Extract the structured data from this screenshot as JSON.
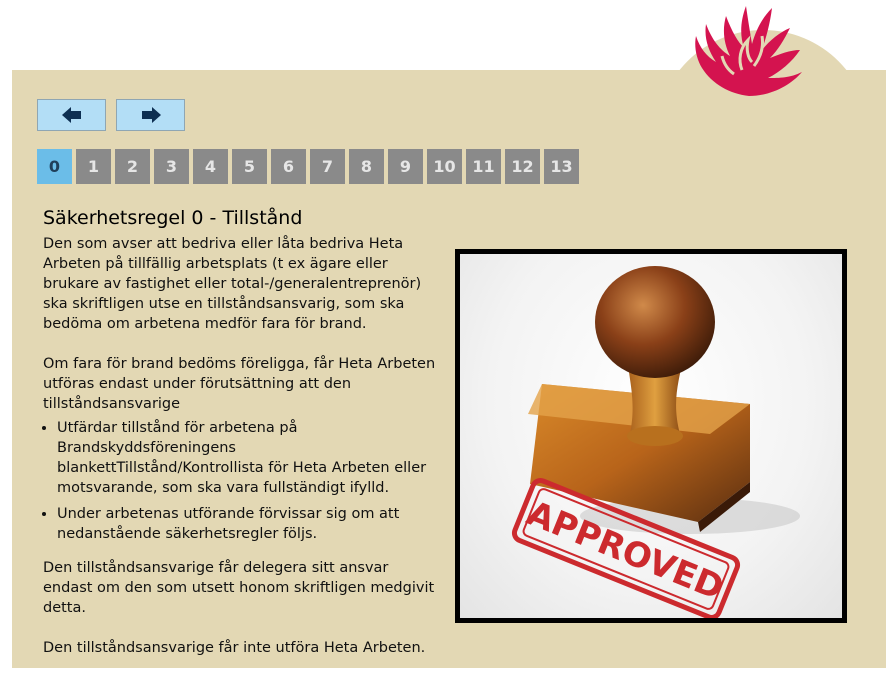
{
  "nav": {
    "prev_icon": "arrow-left-icon",
    "next_icon": "arrow-right-icon"
  },
  "pager": {
    "pages": [
      "0",
      "1",
      "2",
      "3",
      "4",
      "5",
      "6",
      "7",
      "8",
      "9",
      "10",
      "11",
      "12",
      "13"
    ],
    "active": "0"
  },
  "article": {
    "title": "Säkerhetsregel 0 - Tillstånd",
    "para1": "Den som avser att bedriva eller låta bedriva Heta Arbeten på tillfällig arbetsplats (t ex ägare eller brukare av fastighet eller total-/generalentreprenör) ska skriftligen utse en tillståndsansvarig, som ska bedöma om arbetena medför fara för brand.",
    "para2": "Om fara för brand bedöms föreligga, får Heta Arbeten utföras endast under förutsättning att den tillståndsansvarige",
    "bullets": [
      "Utfärdar tillstånd för arbetena på Brandskyddsföreningens blankettTillstånd/Kontrollista för Heta Arbeten eller motsvarande, som ska vara fullständigt ifylld.",
      "Under arbetenas utförande förvissar sig om att nedanstående säkerhetsregler följs."
    ],
    "para3": "Den tillståndsansvarige får delegera sitt ansvar endast om den som utsett honom skriftligen medgivit detta.",
    "para4": "Den tillståndsansvarige får inte utföra Heta Arbeten."
  },
  "photo": {
    "stamp_text": "APPROVED"
  },
  "colors": {
    "panel": "#e3d8b4",
    "nav_button": "#b3def6",
    "page_inactive": "#8a8a8a",
    "page_active": "#6bbde8",
    "logo": "#d4134f",
    "stamp_ink": "#cc2a2e"
  }
}
